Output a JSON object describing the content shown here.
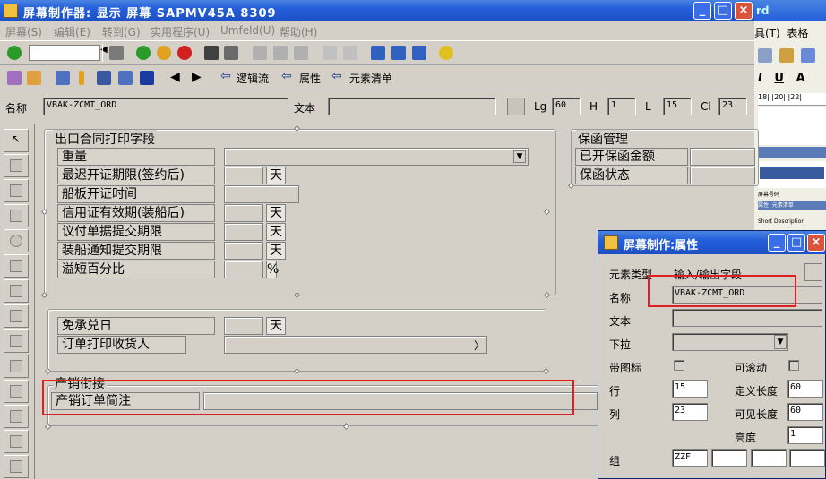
{
  "window": {
    "title": "屏幕制作器:  显示 屏幕 SAPMV45A 8309"
  },
  "menu": [
    "屏幕(S)",
    "编辑(E)",
    "转到(G)",
    "实用程序(U)",
    "Umfeld(U)",
    "帮助(H)"
  ],
  "toolbar2": {
    "logic_flow": "逻辑流",
    "attributes": "属性",
    "element_list": "元素清单"
  },
  "header": {
    "name_label": "名称",
    "name_value": "VBAK-ZCMT_ORD",
    "text_label": "文本",
    "lg_label": "Lg",
    "lg_value": "60",
    "h_label": "H",
    "h_value": "1",
    "l_label": "L",
    "l_value": "15",
    "cl_label": "Cl",
    "cl_value": "23"
  },
  "canvas": {
    "export_frame_title": "出口合同打印字段",
    "export_rows": [
      {
        "label": "重量",
        "unit": ""
      },
      {
        "label": "最迟开证期限(签约后)",
        "unit": "天"
      },
      {
        "label": "船板开证时间",
        "unit": ""
      },
      {
        "label": "信用证有效期(装船后)",
        "unit": "天"
      },
      {
        "label": "议付单据提交期限",
        "unit": "天"
      },
      {
        "label": "装船通知提交期限",
        "unit": "天"
      },
      {
        "label": "溢短百分比",
        "unit": "%"
      }
    ],
    "guarantee_frame_title": "保函管理",
    "guarantee_rows": [
      "已开保函金额",
      "保函状态"
    ],
    "mid_rows": [
      {
        "label": "免承兑日",
        "unit": "天"
      },
      {
        "label": "订单打印收货人",
        "unit": ""
      }
    ],
    "prod_frame_title": "产销衔接",
    "prod_label": "产销订单简注"
  },
  "popup": {
    "title": "屏幕制作:属性",
    "element_type_label": "元素类型",
    "element_type_value": "输入/输出字段",
    "name_label": "名称",
    "name_value": "VBAK-ZCMT_ORD",
    "text_label": "文本",
    "dropdown_label": "下拉",
    "with_icon_label": "带图标",
    "scrollable_label": "可滚动",
    "row_label": "行",
    "row_value": "15",
    "def_len_label": "定义长度",
    "def_len_value": "60",
    "col_label": "列",
    "col_value": "23",
    "vis_len_label": "可见长度",
    "vis_len_value": "60",
    "height_label": "高度",
    "height_value": "1",
    "group_label": "组",
    "group_value": "ZZF"
  },
  "background_app": {
    "title_fragment": "rd",
    "menu_items": [
      "具(T)",
      "表格"
    ],
    "ruler_text": "18| |20| |22|",
    "tabs": [
      "属性",
      "元素清单"
    ],
    "caption_1": "屏幕号码",
    "caption_2": "Short Description"
  },
  "colors": {
    "titlebar": "#245edb",
    "highlight": "#e02020",
    "face": "#d4d0c8"
  }
}
